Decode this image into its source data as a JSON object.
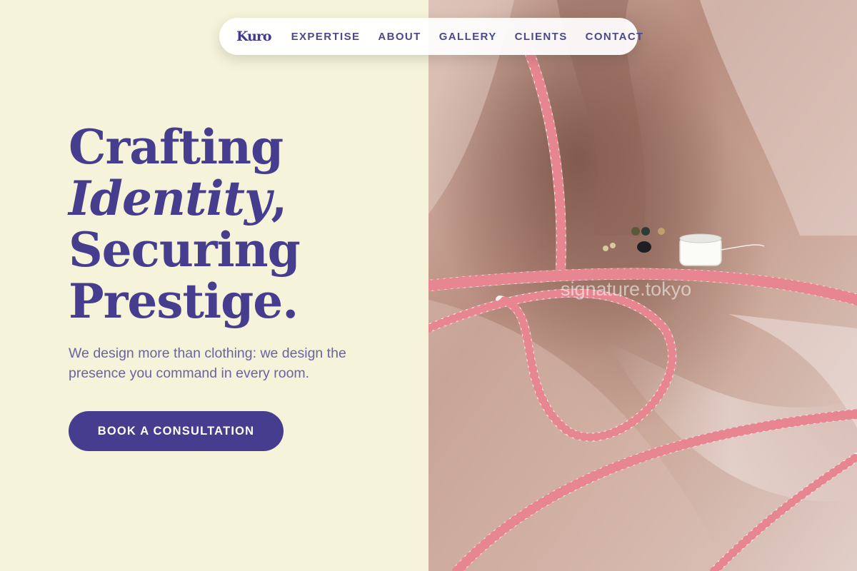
{
  "nav": {
    "logo": "Kuro",
    "links": [
      "EXPERTISE",
      "ABOUT",
      "GALLERY",
      "CLIENTS",
      "CONTACT"
    ]
  },
  "hero": {
    "title_line1": "Crafting",
    "title_line2_italic": "Identity",
    "title_line2_suffix": ",",
    "title_line3": "Securing",
    "title_line4": "Prestige.",
    "subtitle": "We design more than clothing: we design the presence you command in every room.",
    "cta_label": "BOOK A CONSULTATION"
  },
  "image": {
    "watermark": "signature.tokyo"
  },
  "colors": {
    "background": "#f5f4da",
    "accent": "#463d8e",
    "subtitle": "#6a63a2",
    "fabric": "#c9a596",
    "tape_red": "#e05a6a"
  }
}
